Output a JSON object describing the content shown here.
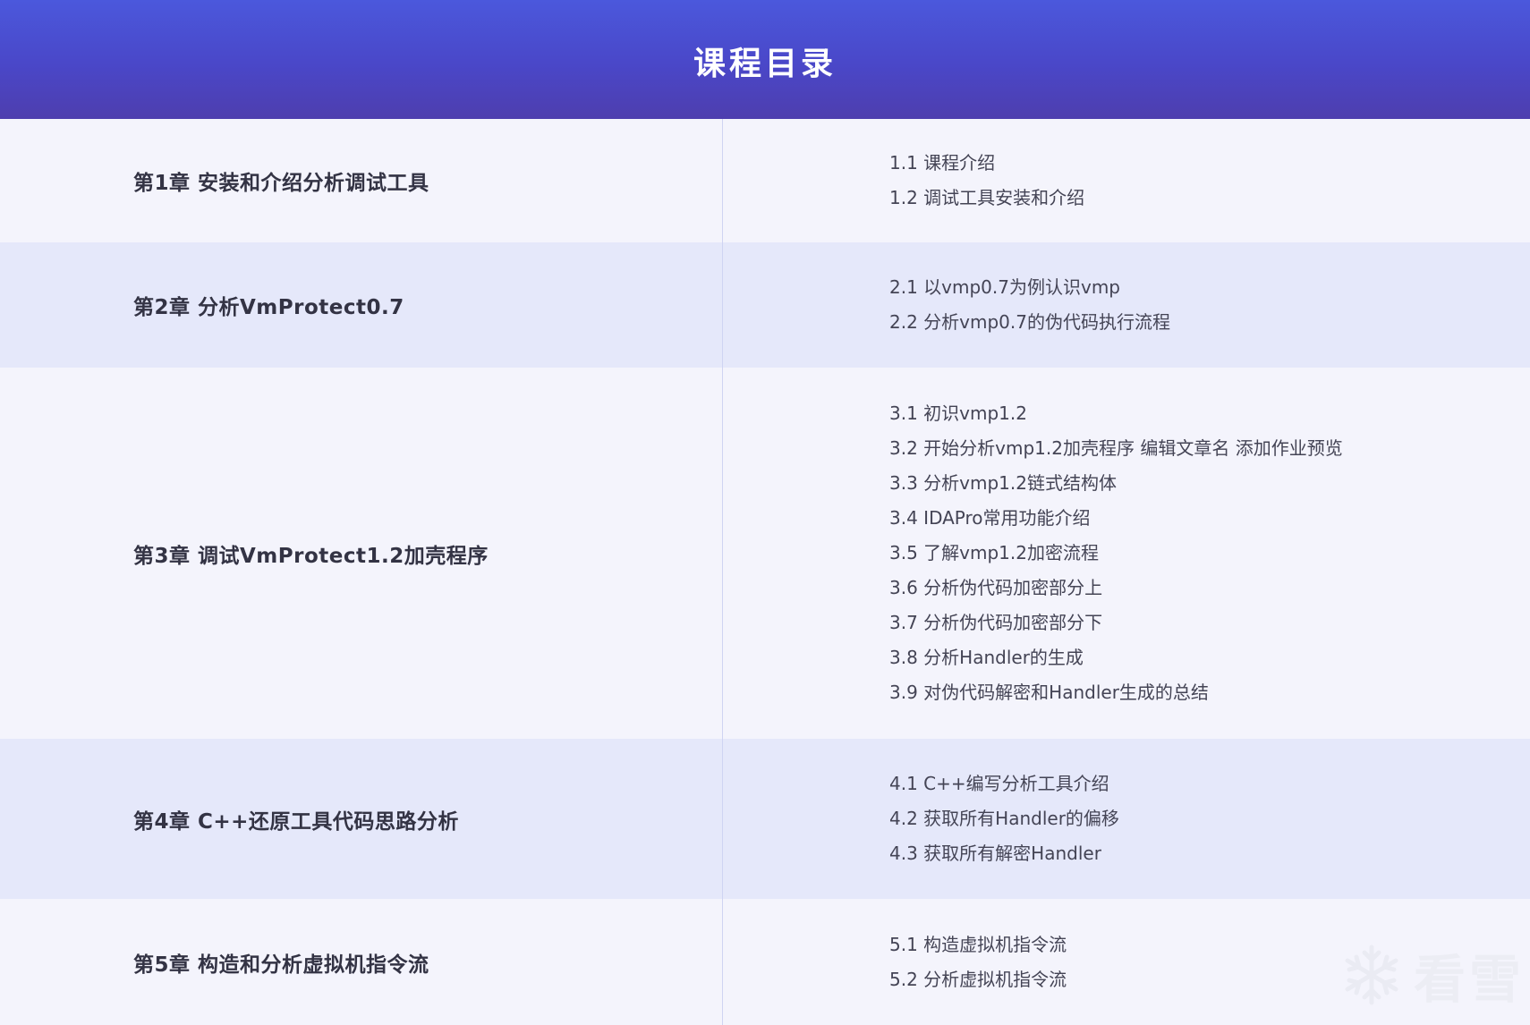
{
  "header": {
    "title": "课程目录"
  },
  "chapters": [
    {
      "title": "第1章 安装和介绍分析调试工具",
      "lessons": [
        "1.1 课程介绍",
        "1.2 调试工具安装和介绍"
      ]
    },
    {
      "title": "第2章 分析VmProtect0.7",
      "lessons": [
        "2.1 以vmp0.7为例认识vmp",
        "2.2 分析vmp0.7的伪代码执行流程"
      ]
    },
    {
      "title": "第3章 调试VmProtect1.2加壳程序",
      "lessons": [
        "3.1 初识vmp1.2",
        "3.2 开始分析vmp1.2加壳程序 编辑文章名 添加作业预览",
        "3.3 分析vmp1.2链式结构体",
        "3.4 IDAPro常用功能介绍",
        "3.5 了解vmp1.2加密流程",
        "3.6 分析伪代码加密部分上",
        "3.7 分析伪代码加密部分下",
        "3.8 分析Handler的生成",
        "3.9 对伪代码解密和Handler生成的总结"
      ]
    },
    {
      "title": "第4章 C++还原工具代码思路分析",
      "lessons": [
        "4.1 C++编写分析工具介绍",
        "4.2 获取所有Handler的偏移",
        "4.3 获取所有解密Handler"
      ]
    },
    {
      "title": "第5章 构造和分析虚拟机指令流",
      "lessons": [
        "5.1 构造虚拟机指令流",
        "5.2 分析虚拟机指令流"
      ]
    }
  ],
  "watermark": {
    "text": "看雪",
    "icon": "snowflake-icon"
  },
  "colors": {
    "header_top": "#4b58dc",
    "header_bottom": "#4e3eae",
    "row_light": "#f4f4fc",
    "row_dark": "#e5e8fa",
    "divider": "#cfd4f2"
  }
}
